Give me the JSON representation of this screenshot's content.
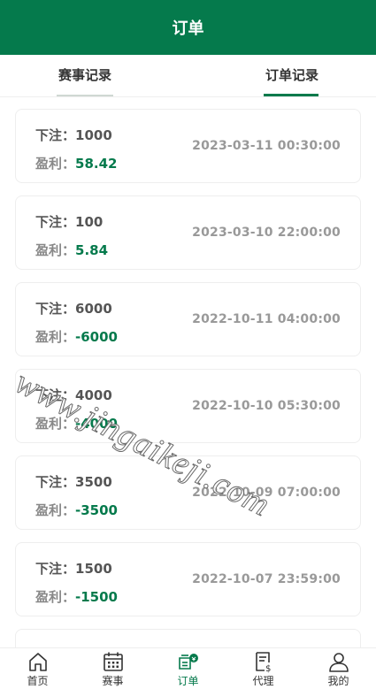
{
  "header": {
    "title": "订单"
  },
  "tabs": [
    {
      "label": "赛事记录"
    },
    {
      "label": "订单记录"
    }
  ],
  "orders": [
    {
      "bet_label": "下注：",
      "bet": "1000",
      "profit_label": "盈利：",
      "profit": "58.42",
      "time": "2023-03-11 00:30:00"
    },
    {
      "bet_label": "下注：",
      "bet": "100",
      "profit_label": "盈利：",
      "profit": "5.84",
      "time": "2023-03-10 22:00:00"
    },
    {
      "bet_label": "下注：",
      "bet": "6000",
      "profit_label": "盈利：",
      "profit": "-6000",
      "time": "2022-10-11 04:00:00"
    },
    {
      "bet_label": "下注：",
      "bet": "4000",
      "profit_label": "盈利：",
      "profit": "-4000",
      "time": "2022-10-10 05:30:00"
    },
    {
      "bet_label": "下注：",
      "bet": "3500",
      "profit_label": "盈利：",
      "profit": "-3500",
      "time": "2022-10-09 07:00:00"
    },
    {
      "bet_label": "下注：",
      "bet": "1500",
      "profit_label": "盈利：",
      "profit": "-1500",
      "time": "2022-10-07 23:59:00"
    }
  ],
  "watermark": "www.jingaikeji.com",
  "tabbar": [
    {
      "label": "首页",
      "icon": "home-icon"
    },
    {
      "label": "赛事",
      "icon": "calendar-icon"
    },
    {
      "label": "订单",
      "icon": "order-icon"
    },
    {
      "label": "代理",
      "icon": "agent-icon"
    },
    {
      "label": "我的",
      "icon": "user-icon"
    }
  ],
  "colors": {
    "brand": "#057a4c",
    "text": "#333333",
    "muted": "#999999"
  }
}
